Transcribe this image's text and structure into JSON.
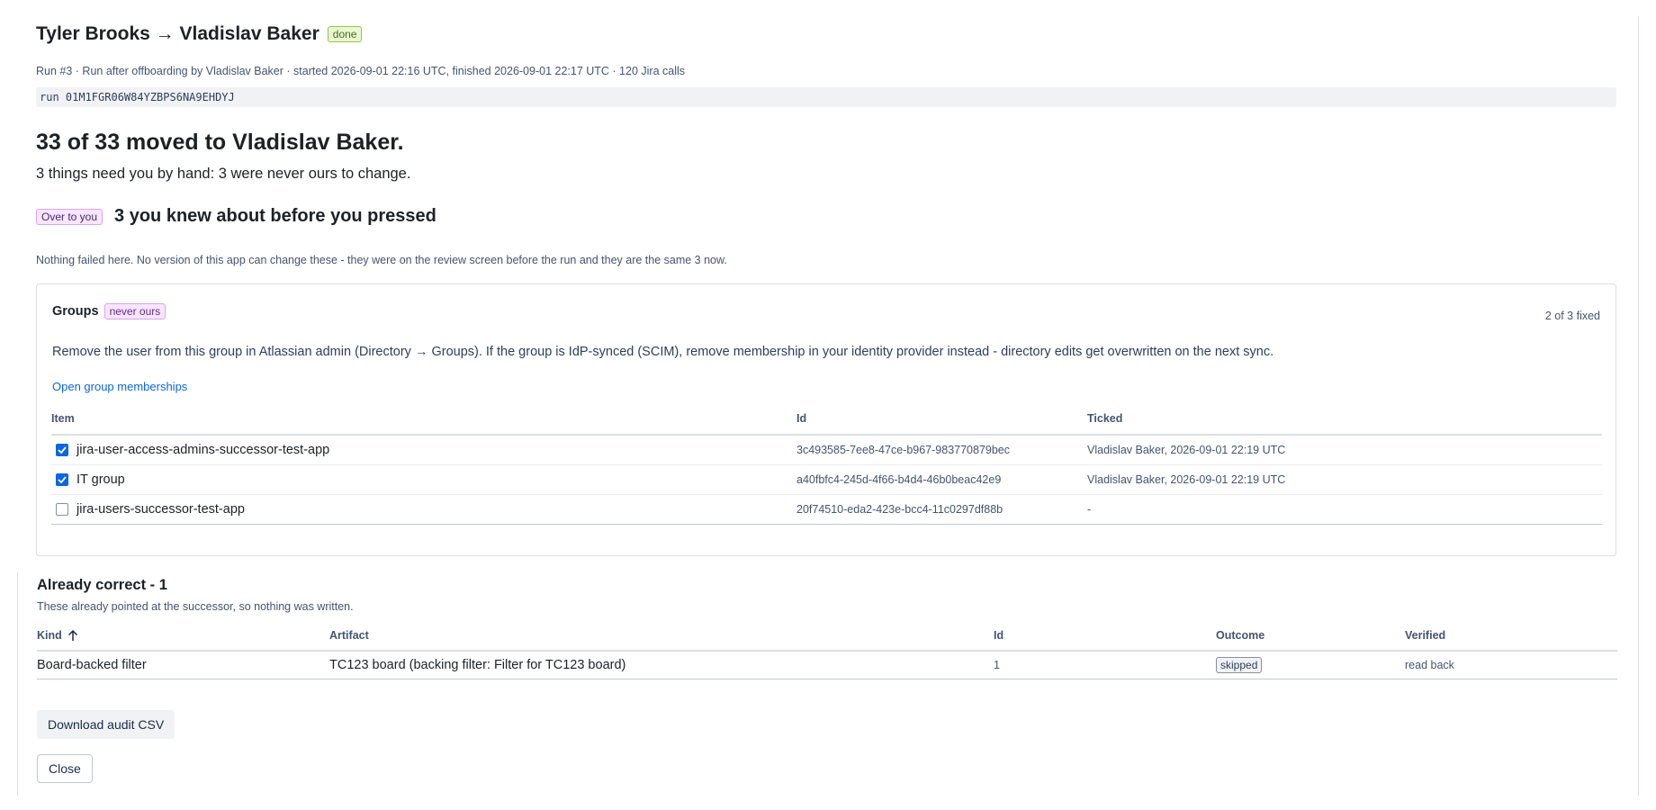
{
  "header": {
    "title": "Tyler Brooks → Vladislav Baker",
    "status_badge": "done",
    "meta": "Run #3 · Run after offboarding by Vladislav Baker · started 2026-09-01 22:16 UTC, finished 2026-09-01 22:17 UTC · 120 Jira calls",
    "run_id": "run 01M1FGR06W84YZBPS6NA9EHDYJ"
  },
  "summary": {
    "headline": "33 of 33 moved to Vladislav Baker.",
    "subhead": "3 things need you by hand: 3 were never ours to change."
  },
  "over_to_you": {
    "badge": "Over to you",
    "title": "3 you knew about before you pressed",
    "note": "Nothing failed here. No version of this app can change these - they were on the review screen before the run and they are the same 3 now."
  },
  "groups_panel": {
    "title": "Groups",
    "badge": "never ours",
    "fixed_count": "2 of 3 fixed",
    "instructions": "Remove the user from this group in Atlassian admin (Directory → Groups). If the group is IdP-synced (SCIM), remove membership in your identity provider instead - directory edits get overwritten on the next sync.",
    "link": "Open group memberships",
    "columns": [
      "Item",
      "Id",
      "Ticked"
    ],
    "rows": [
      {
        "checked": true,
        "item": "jira-user-access-admins-successor-test-app",
        "id": "3c493585-7ee8-47ce-b967-983770879bec",
        "ticked": "Vladislav Baker, 2026-09-01 22:19 UTC"
      },
      {
        "checked": true,
        "item": "IT group",
        "id": "a40fbfc4-245d-4f66-b4d4-46b0beac42e9",
        "ticked": "Vladislav Baker, 2026-09-01 22:19 UTC"
      },
      {
        "checked": false,
        "item": "jira-users-successor-test-app",
        "id": "20f74510-eda2-423e-bcc4-11c0297df88b",
        "ticked": "-"
      }
    ]
  },
  "already_correct": {
    "title": "Already correct - 1",
    "description": "These already pointed at the successor, so nothing was written.",
    "columns": [
      "Kind",
      "Artifact",
      "Id",
      "Outcome",
      "Verified"
    ],
    "rows": [
      {
        "kind": "Board-backed filter",
        "artifact": "TC123 board (backing filter: Filter for TC123 board)",
        "id": "1",
        "outcome": "skipped",
        "verified": "read back"
      }
    ]
  },
  "actions": {
    "download": "Download audit CSV",
    "close": "Close"
  },
  "icons": {
    "checkbox_checked": "checkbox-checked-icon",
    "checkbox_unchecked": "checkbox-unchecked-icon",
    "sort": "arrow-up-icon"
  },
  "colors": {
    "accent": "#0c66e4",
    "done_badge_bg": "#e9f8d2",
    "purple_badge_bg": "#f8e6ff"
  }
}
